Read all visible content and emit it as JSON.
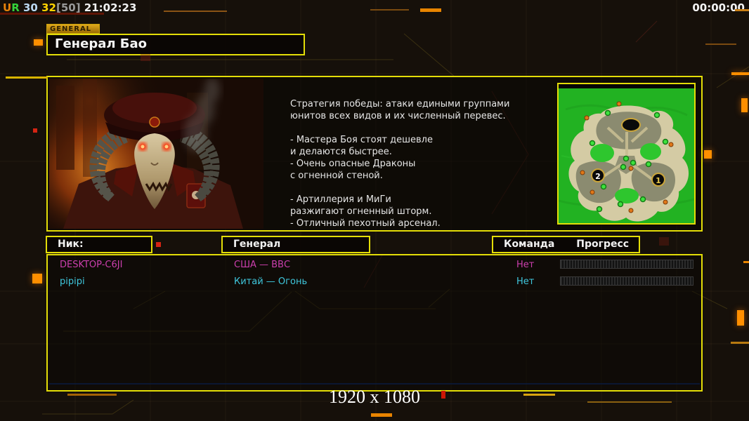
{
  "status_bar": {
    "u": "U",
    "r": "R",
    "stat1": "30",
    "stat2": "32",
    "stat3": "[50]",
    "clock": "21:02:23",
    "match_timer": "00:00:00"
  },
  "general_tab_label": "GENERAL",
  "page_title": "Генерал Бао",
  "description_lines": [
    "Стратегия победы: атаки едиными группами",
    "юнитов всех видов и их численный перевес.",
    "",
    "- Мастера Боя стоят дешевле",
    "и делаются быстрее.",
    "- Очень опасные Драконы",
    "с огненной стеной.",
    "",
    "- Артиллерия и МиГи",
    "разжигают огненный шторм.",
    "- Отличный пехотный арсенал."
  ],
  "map": {
    "start1": "1",
    "start2": "2"
  },
  "headers": {
    "nick": "Ник:",
    "general": "Генерал",
    "team": "Команда",
    "progress": "Прогресс"
  },
  "players": [
    {
      "name": "DESKTOP-C6JI",
      "general": "США — ВВС",
      "team": "Нет",
      "color": "#cc3fae"
    },
    {
      "name": "pipipi",
      "general": "Китай — Огонь",
      "team": "Нет",
      "color": "#3fc7dd"
    }
  ],
  "footer": {
    "resolution": "1920 x 1080"
  },
  "colors": {
    "accent_yellow": "#e3dd07",
    "decor_orange": "#ff8f00",
    "decor_red": "#d42413",
    "magenta_player": "#cc3fae",
    "cyan_player": "#3fc7dd",
    "map_grass": "#22b222",
    "map_sand": "#d4cba4"
  }
}
